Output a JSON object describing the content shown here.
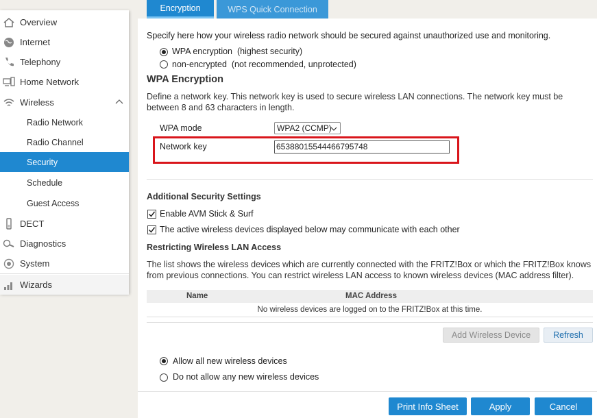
{
  "sidebar": {
    "items": [
      {
        "label": "Overview",
        "icon": "home-icon"
      },
      {
        "label": "Internet",
        "icon": "globe-icon"
      },
      {
        "label": "Telephony",
        "icon": "phone-icon"
      },
      {
        "label": "Home Network",
        "icon": "network-icon"
      },
      {
        "label": "Wireless",
        "icon": "wifi-icon",
        "expanded": true
      },
      {
        "label": "Radio Network"
      },
      {
        "label": "Radio Channel"
      },
      {
        "label": "Security",
        "active": true
      },
      {
        "label": "Schedule"
      },
      {
        "label": "Guest Access"
      },
      {
        "label": "DECT",
        "icon": "dect-handset-icon"
      },
      {
        "label": "Diagnostics",
        "icon": "diagnostics-icon"
      },
      {
        "label": "System",
        "icon": "system-gear-icon"
      },
      {
        "label": "Wizards",
        "icon": "wizard-signal-icon"
      }
    ]
  },
  "tabs": [
    {
      "label": "Encryption",
      "active": true
    },
    {
      "label": "WPS Quick Connection",
      "active": false
    }
  ],
  "intro": "Specify here how your wireless radio network should be secured against unauthorized use and monitoring.",
  "security_mode": {
    "options": [
      {
        "label": "WPA encryption",
        "note": "(highest security)",
        "selected": true
      },
      {
        "label": "non-encrypted",
        "note": "(not recommended, unprotected)",
        "selected": false
      }
    ]
  },
  "wpa": {
    "heading": "WPA Encryption",
    "description": "Define a network key. This network key is used to secure wireless LAN connections. The network key must be between 8 and 63 characters in length.",
    "mode_label": "WPA mode",
    "mode_value": "WPA2 (CCMP)",
    "key_label": "Network key",
    "key_value": "65388015544466795748"
  },
  "additional": {
    "heading": "Additional Security Settings",
    "checkboxes": [
      {
        "label": "Enable AVM Stick & Surf",
        "checked": true
      },
      {
        "label": "The active wireless devices displayed below may communicate with each other",
        "checked": true
      }
    ]
  },
  "restrict": {
    "heading": "Restricting Wireless LAN Access",
    "description": "The list shows the wireless devices which are currently connected with the FRITZ!Box or which the FRITZ!Box knows from previous connections. You can restrict wireless LAN access to known wireless devices (MAC address filter).",
    "columns": [
      "Name",
      "MAC Address"
    ],
    "empty_text": "No wireless devices are logged on to the FRITZ!Box at this time.",
    "add_button": "Add Wireless Device",
    "refresh_button": "Refresh",
    "policy_options": [
      {
        "label": "Allow all new wireless devices",
        "selected": true
      },
      {
        "label": "Do not allow any new wireless devices",
        "selected": false
      }
    ]
  },
  "footer": {
    "print_button": "Print Info Sheet",
    "apply_button": "Apply",
    "cancel_button": "Cancel"
  },
  "colors": {
    "accent": "#1f88d0",
    "highlight_border": "#d9151b"
  }
}
